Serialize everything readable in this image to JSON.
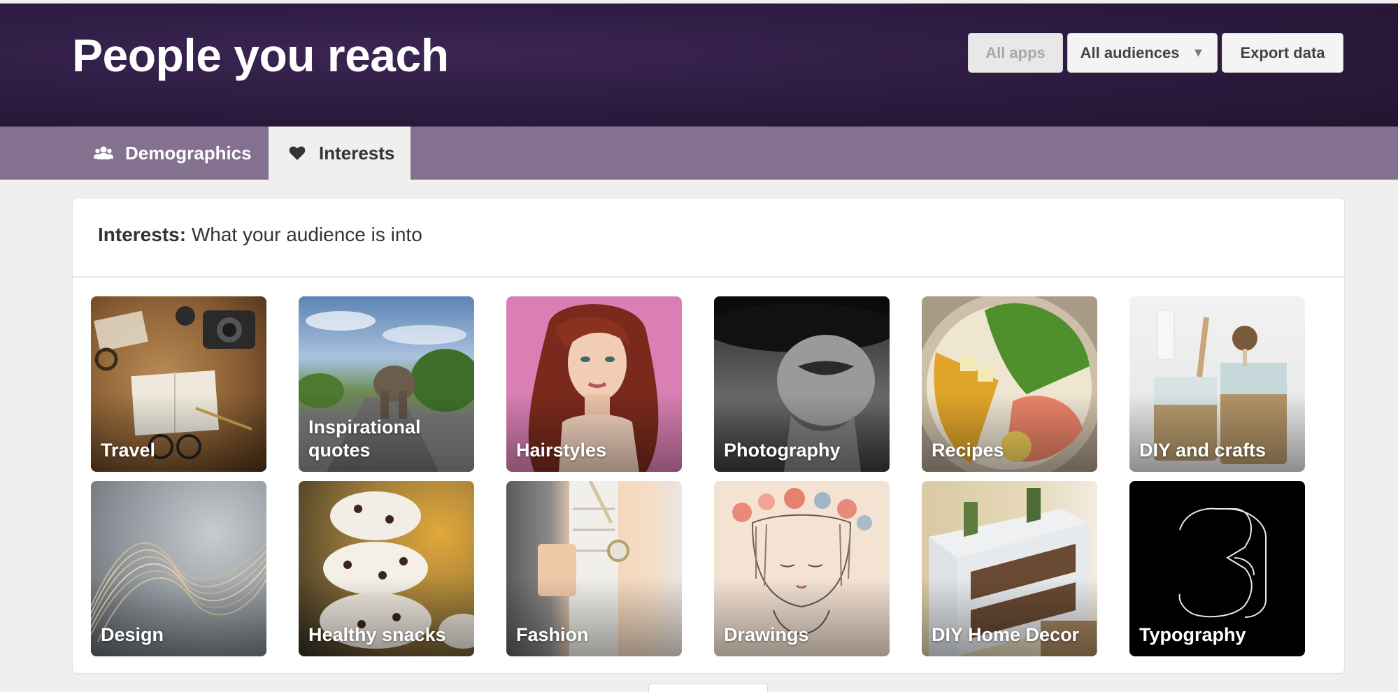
{
  "header": {
    "title": "People you reach",
    "buttons": {
      "all_apps": "All apps",
      "all_audiences": "All audiences",
      "export": "Export data"
    }
  },
  "tabs": [
    {
      "label": "Demographics",
      "icon": "users-icon",
      "active": false
    },
    {
      "label": "Interests",
      "icon": "heart-icon",
      "active": true
    }
  ],
  "interests": {
    "heading_strong": "Interests:",
    "heading_text": " What your audience is into",
    "tiles": [
      {
        "label": "Travel",
        "image": "travel-photo"
      },
      {
        "label": "Inspirational quotes",
        "image": "elephant-road-photo"
      },
      {
        "label": "Hairstyles",
        "image": "red-hair-portrait"
      },
      {
        "label": "Photography",
        "image": "black-hat-lips-photo"
      },
      {
        "label": "Recipes",
        "image": "pasta-salad-bowl"
      },
      {
        "label": "DIY and crafts",
        "image": "rope-jars-photo"
      },
      {
        "label": "Design",
        "image": "wavy-lines-art"
      },
      {
        "label": "Healthy snacks",
        "image": "chocolate-chip-bites"
      },
      {
        "label": "Fashion",
        "image": "peach-blazer-outfit"
      },
      {
        "label": "Drawings",
        "image": "flower-crown-sketch"
      },
      {
        "label": "DIY Home Decor",
        "image": "pallet-shelf-photo"
      },
      {
        "label": "Typography",
        "image": "number-3-lettering"
      }
    ]
  },
  "colors": {
    "header_bg": "#2c1a40",
    "tabbar_bg": "#83718f",
    "page_bg": "#efefef"
  }
}
